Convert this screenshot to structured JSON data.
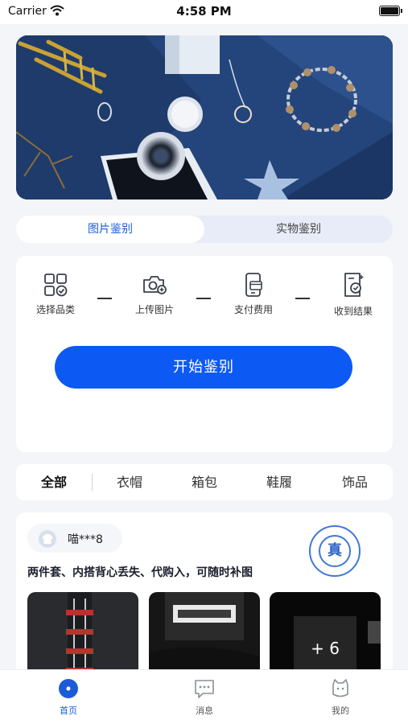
{
  "status_bar": {
    "carrier": "Carrier",
    "time": "4:58 PM"
  },
  "banner": {
    "image": "jewelry-and-phone-photo",
    "background_color": "#27457a"
  },
  "mode_tabs": [
    {
      "label": "图片鉴别",
      "active": true
    },
    {
      "label": "实物鉴别",
      "active": false
    }
  ],
  "steps": [
    {
      "label": "选择品类",
      "icon": "grid-check-icon"
    },
    {
      "label": "上传图片",
      "icon": "camera-plus-icon"
    },
    {
      "label": "支付费用",
      "icon": "phone-card-icon"
    },
    {
      "label": "收到结果",
      "icon": "report-stamp-icon"
    }
  ],
  "start_button": {
    "label": "开始鉴别",
    "color": "#0c5af3"
  },
  "categories": [
    {
      "label": "全部",
      "active": true
    },
    {
      "label": "衣帽",
      "active": false
    },
    {
      "label": "箱包",
      "active": false
    },
    {
      "label": "鞋履",
      "active": false
    },
    {
      "label": "饰品",
      "active": false
    }
  ],
  "post": {
    "username": "喵***8",
    "stamp_text": "真",
    "title": "两件套、内搭背心丢失、代购入，可随时补图",
    "more_count": "+ 6"
  },
  "bottom_nav": [
    {
      "label": "首页",
      "icon": "home-dot-icon",
      "active": true
    },
    {
      "label": "消息",
      "icon": "message-icon",
      "active": false
    },
    {
      "label": "我的",
      "icon": "profile-cat-icon",
      "active": false
    }
  ],
  "colors": {
    "accent": "#1c5bd8",
    "primary_button": "#0c5af3",
    "page_bg": "#f4f5f8"
  }
}
